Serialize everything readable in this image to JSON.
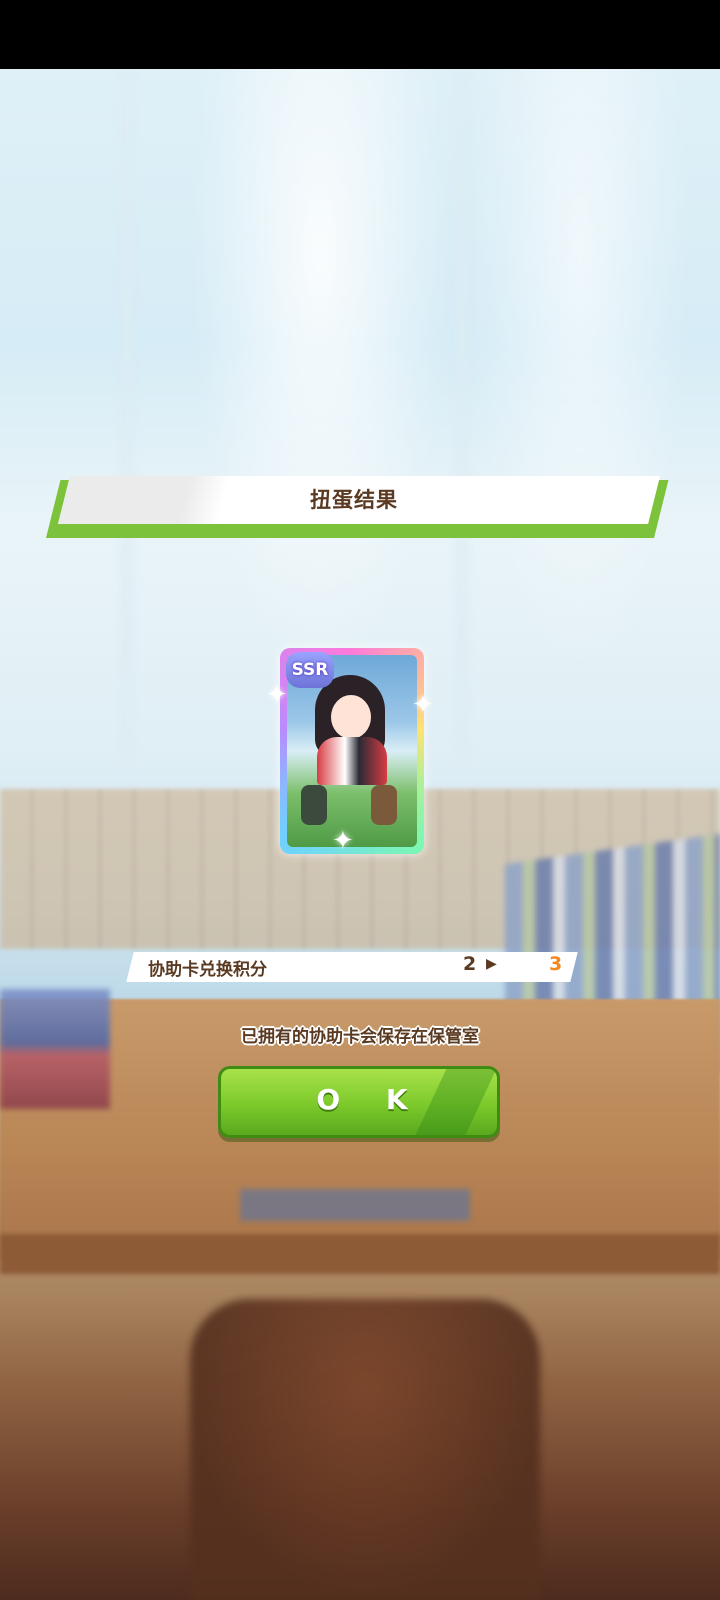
{
  "dialog": {
    "title": "扭蛋结果",
    "card": {
      "rarity": "SSR"
    },
    "points": {
      "label": "协助卡兑换积分",
      "from": "2",
      "to": "3"
    },
    "info": "已拥有的协助卡会保存在保管室",
    "ok_button": "O K"
  },
  "colors": {
    "accent_green": "#7cc23a",
    "text_brown": "#5b3a22",
    "points_orange": "#f08a1e"
  }
}
